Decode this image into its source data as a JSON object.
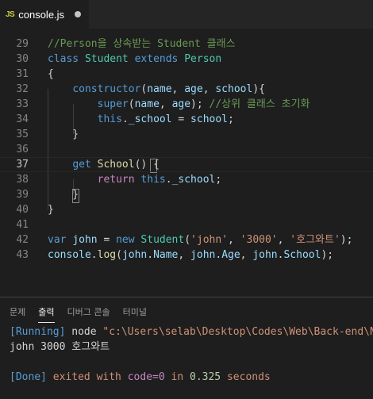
{
  "tab": {
    "icon_label": "JS",
    "file_name": "console.js",
    "icon_color": "#cbcb41"
  },
  "editor": {
    "lines": [
      {
        "num": "29",
        "tokens": [
          {
            "t": "//Person을 상속받는 Student 클래스",
            "c": "com"
          }
        ]
      },
      {
        "num": "30",
        "tokens": [
          {
            "t": "class ",
            "c": "kw"
          },
          {
            "t": "Student",
            "c": "cls"
          },
          {
            "t": " extends ",
            "c": "kw"
          },
          {
            "t": "Person",
            "c": "cls"
          }
        ]
      },
      {
        "num": "31",
        "tokens": [
          {
            "t": "{",
            "c": "pun"
          }
        ]
      },
      {
        "num": "32",
        "tokens": [
          {
            "t": "    ",
            "c": "pun"
          },
          {
            "t": "constructor",
            "c": "kw"
          },
          {
            "t": "(",
            "c": "pun"
          },
          {
            "t": "name",
            "c": "var"
          },
          {
            "t": ", ",
            "c": "pun"
          },
          {
            "t": "age",
            "c": "var"
          },
          {
            "t": ", ",
            "c": "pun"
          },
          {
            "t": "school",
            "c": "var"
          },
          {
            "t": "){",
            "c": "pun"
          }
        ]
      },
      {
        "num": "33",
        "tokens": [
          {
            "t": "        ",
            "c": "pun"
          },
          {
            "t": "super",
            "c": "kw"
          },
          {
            "t": "(",
            "c": "pun"
          },
          {
            "t": "name",
            "c": "var"
          },
          {
            "t": ", ",
            "c": "pun"
          },
          {
            "t": "age",
            "c": "var"
          },
          {
            "t": "); ",
            "c": "pun"
          },
          {
            "t": "//상위 클래스 초기화",
            "c": "com"
          }
        ]
      },
      {
        "num": "34",
        "tokens": [
          {
            "t": "        ",
            "c": "pun"
          },
          {
            "t": "this",
            "c": "kw"
          },
          {
            "t": ".",
            "c": "pun"
          },
          {
            "t": "_school",
            "c": "var"
          },
          {
            "t": " = ",
            "c": "pun"
          },
          {
            "t": "school",
            "c": "var"
          },
          {
            "t": ";",
            "c": "pun"
          }
        ]
      },
      {
        "num": "35",
        "tokens": [
          {
            "t": "    }",
            "c": "pun"
          }
        ]
      },
      {
        "num": "36",
        "tokens": []
      },
      {
        "num": "37",
        "tokens": [
          {
            "t": "    ",
            "c": "pun"
          },
          {
            "t": "get",
            "c": "kw"
          },
          {
            "t": " ",
            "c": "pun"
          },
          {
            "t": "School",
            "c": "fn"
          },
          {
            "t": "() {",
            "c": "pun"
          }
        ]
      },
      {
        "num": "38",
        "tokens": [
          {
            "t": "        ",
            "c": "pun"
          },
          {
            "t": "return",
            "c": "ctl"
          },
          {
            "t": " ",
            "c": "pun"
          },
          {
            "t": "this",
            "c": "kw"
          },
          {
            "t": ".",
            "c": "pun"
          },
          {
            "t": "_school",
            "c": "var"
          },
          {
            "t": ";",
            "c": "pun"
          }
        ]
      },
      {
        "num": "39",
        "tokens": [
          {
            "t": "    }",
            "c": "pun"
          }
        ]
      },
      {
        "num": "40",
        "tokens": [
          {
            "t": "}",
            "c": "pun"
          }
        ]
      },
      {
        "num": "41",
        "tokens": []
      },
      {
        "num": "42",
        "tokens": [
          {
            "t": "var",
            "c": "kw"
          },
          {
            "t": " ",
            "c": "pun"
          },
          {
            "t": "john",
            "c": "var"
          },
          {
            "t": " = ",
            "c": "pun"
          },
          {
            "t": "new",
            "c": "kw"
          },
          {
            "t": " ",
            "c": "pun"
          },
          {
            "t": "Student",
            "c": "cls"
          },
          {
            "t": "(",
            "c": "pun"
          },
          {
            "t": "'john'",
            "c": "str"
          },
          {
            "t": ", ",
            "c": "pun"
          },
          {
            "t": "'3000'",
            "c": "str"
          },
          {
            "t": ", ",
            "c": "pun"
          },
          {
            "t": "'호그와트'",
            "c": "str"
          },
          {
            "t": ");",
            "c": "pun"
          }
        ]
      },
      {
        "num": "43",
        "tokens": [
          {
            "t": "console",
            "c": "var"
          },
          {
            "t": ".",
            "c": "pun"
          },
          {
            "t": "log",
            "c": "fn"
          },
          {
            "t": "(",
            "c": "pun"
          },
          {
            "t": "john",
            "c": "var"
          },
          {
            "t": ".",
            "c": "pun"
          },
          {
            "t": "Name",
            "c": "var"
          },
          {
            "t": ", ",
            "c": "pun"
          },
          {
            "t": "john",
            "c": "var"
          },
          {
            "t": ".",
            "c": "pun"
          },
          {
            "t": "Age",
            "c": "var"
          },
          {
            "t": ", ",
            "c": "pun"
          },
          {
            "t": "john",
            "c": "var"
          },
          {
            "t": ".",
            "c": "pun"
          },
          {
            "t": "School",
            "c": "var"
          },
          {
            "t": ");",
            "c": "pun"
          }
        ]
      }
    ],
    "current_line": "37"
  },
  "panel": {
    "tabs": [
      {
        "label": "문제",
        "active": false
      },
      {
        "label": "출력",
        "active": true
      },
      {
        "label": "디버그 콘솔",
        "active": false
      },
      {
        "label": "터미널",
        "active": false
      }
    ],
    "output": {
      "running_tag": "[Running]",
      "running_cmd": " node ",
      "running_path": "\"c:\\Users\\selab\\Desktop\\Codes\\Web\\Back-end\\No",
      "result": "john 3000 호그와트",
      "done_tag": "[Done]",
      "done_exited": " exited with ",
      "done_code": "code=0",
      "done_in": " in ",
      "done_secs": "0.325",
      "done_seconds": " seconds"
    }
  }
}
